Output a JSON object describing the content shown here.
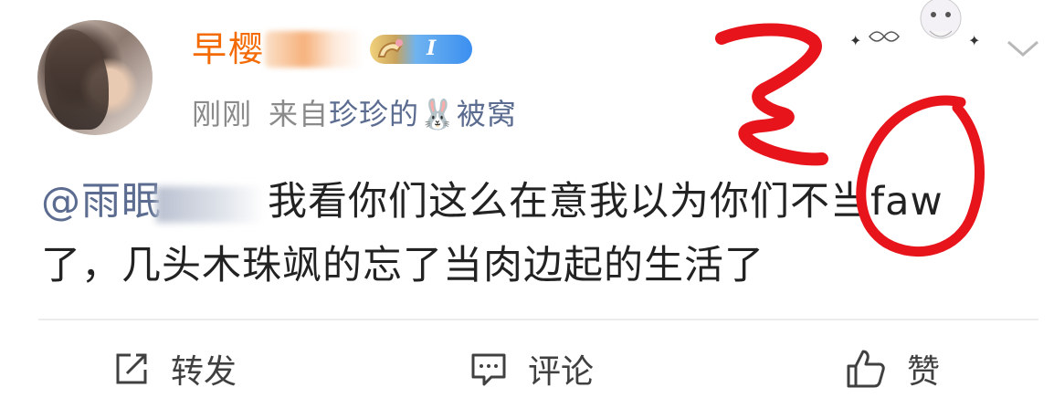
{
  "post": {
    "username": "早樱",
    "badge_level": "I",
    "time": "刚刚",
    "source_prefix": "来自",
    "source_name_a": "珍珍的",
    "source_emoji": "🐰",
    "source_name_b": "被窝",
    "mention": "@雨",
    "mention_partial": "眠",
    "body_line_1": "我看你们这么在意我以为你们不当faw",
    "body_line_2": "了，几头木珠飒的忘了当肉边起的生活了"
  },
  "actions": {
    "repost_label": "转发",
    "comment_label": "评论",
    "like_label": "赞"
  },
  "icons": {
    "more": "chevron-down-icon",
    "repost": "share-square-icon",
    "comment": "comment-bubble-icon",
    "like": "thumbs-up-icon"
  },
  "colors": {
    "username": "#f46b06",
    "link": "#5b6c90",
    "meta": "#8a8a8a",
    "annotation": "#e8141c"
  }
}
